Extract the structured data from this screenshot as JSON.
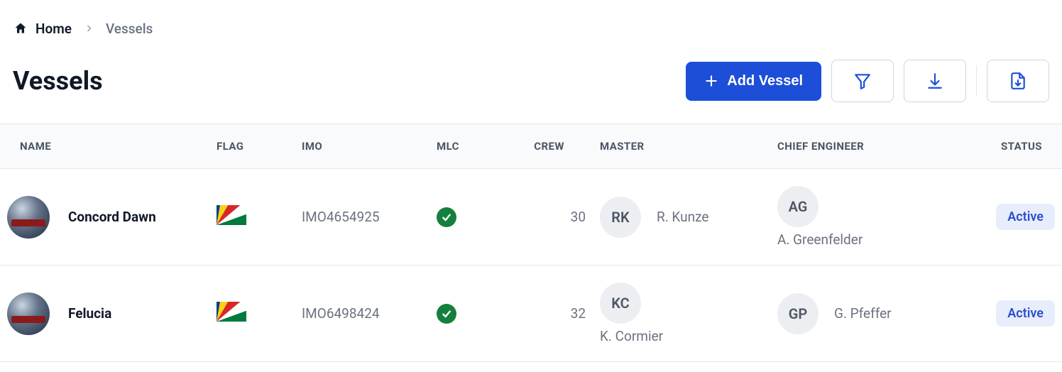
{
  "breadcrumb": {
    "home_label": "Home",
    "current": "Vessels"
  },
  "page": {
    "title": "Vessels"
  },
  "actions": {
    "add_label": "Add Vessel"
  },
  "icons": {
    "home": "home-icon",
    "chevron_right": "chevron-right-icon",
    "plus": "plus-icon",
    "filter": "filter-icon",
    "download": "download-icon",
    "file_download": "file-download-icon",
    "check": "check-icon"
  },
  "table": {
    "headers": {
      "name": "NAME",
      "flag": "FLAG",
      "imo": "IMO",
      "mlc": "MLC",
      "crew": "CREW",
      "master": "MASTER",
      "chief_engineer": "CHIEF ENGINEER",
      "status": "STATUS"
    },
    "rows": [
      {
        "name": "Concord Dawn",
        "flag": "seychelles",
        "imo": "IMO4654925",
        "mlc": true,
        "crew": "30",
        "master": {
          "initials": "RK",
          "name": "R. Kunze"
        },
        "chief_engineer": {
          "initials": "AG",
          "name": "A. Greenfelder"
        },
        "status": "Active"
      },
      {
        "name": "Felucia",
        "flag": "seychelles",
        "imo": "IMO6498424",
        "mlc": true,
        "crew": "32",
        "master": {
          "initials": "KC",
          "name": "K. Cormier"
        },
        "chief_engineer": {
          "initials": "GP",
          "name": "G. Pfeffer"
        },
        "status": "Active"
      }
    ]
  },
  "colors": {
    "primary": "#1d4ed8",
    "badge_bg": "#e7edfb",
    "badge_text": "#2b4fd1",
    "mlc_check": "#15803d"
  }
}
